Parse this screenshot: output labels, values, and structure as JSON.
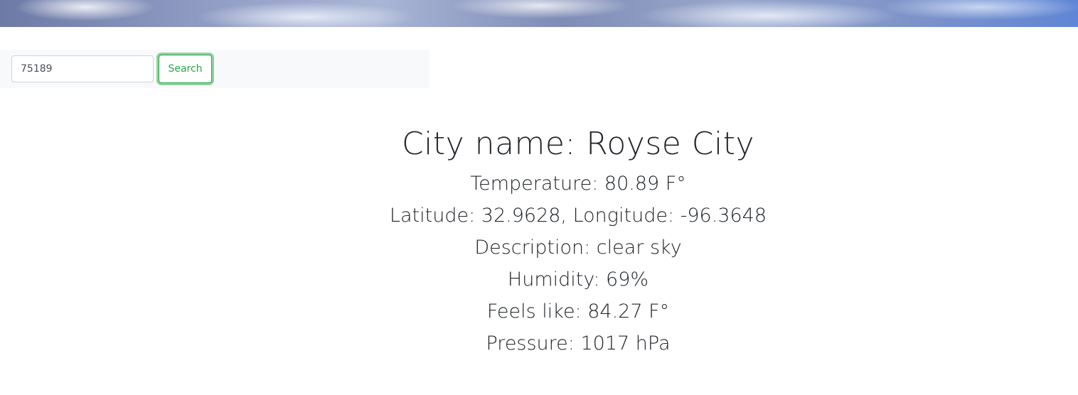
{
  "search": {
    "value": "75189",
    "button_label": "Search"
  },
  "weather": {
    "city_line": "City name: Royse City",
    "temperature_line": "Temperature: 80.89 F°",
    "coordinates_line": "Latitude: 32.9628, Longitude: -96.3648",
    "description_line": "Description: clear sky",
    "humidity_line": "Humidity: 69%",
    "feels_like_line": "Feels like: 84.27 F°",
    "pressure_line": "Pressure: 1017 hPa"
  },
  "colors": {
    "accent": "#28a745",
    "text": "#212529",
    "search_bar_bg": "#f8f9fa"
  }
}
